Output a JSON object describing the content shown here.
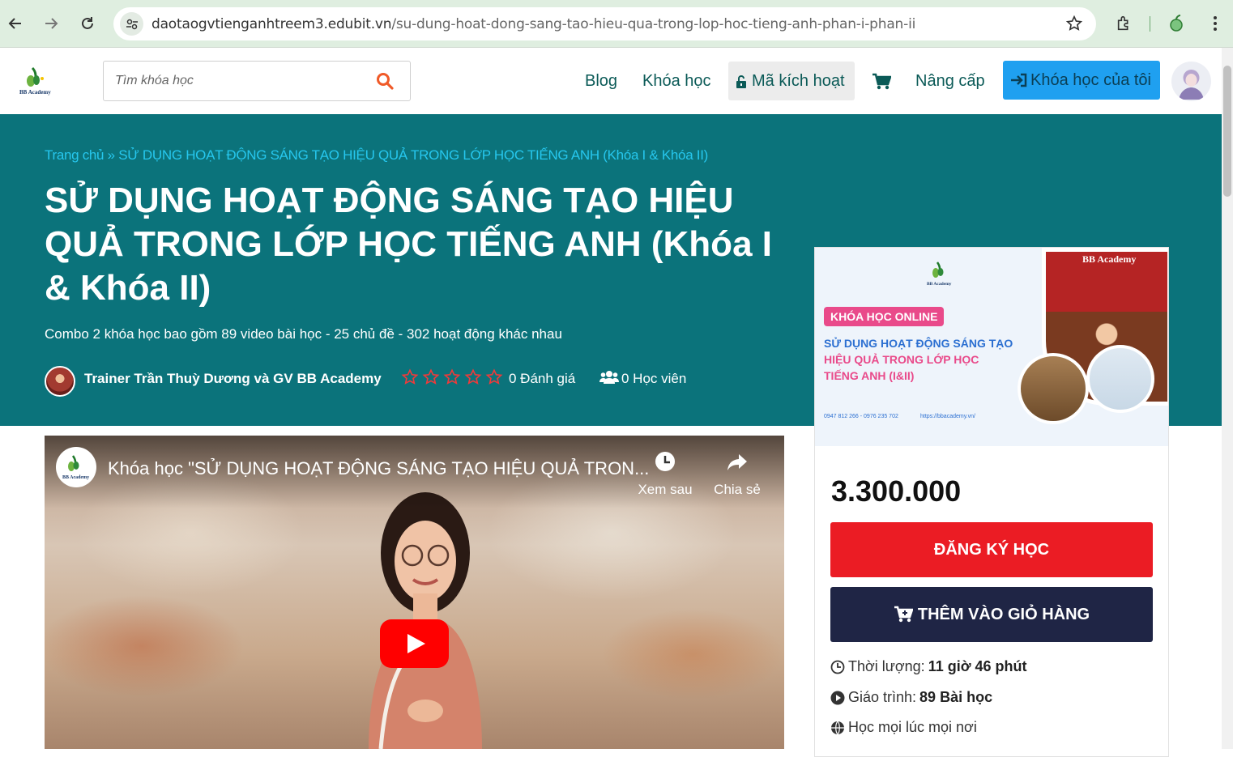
{
  "browser": {
    "url_host": "daotaogvtienganhtreem3.edubit.vn",
    "url_path": "/su-dung-hoat-dong-sang-tao-hieu-qua-trong-lop-hoc-tieng-anh-phan-i-phan-ii"
  },
  "header": {
    "logo_text": "BB Academy",
    "search_placeholder": "Tìm khóa học",
    "nav": {
      "blog": "Blog",
      "courses": "Khóa học",
      "activation": "Mã kích hoạt",
      "upgrade": "Nâng cấp",
      "my_courses": "Khóa học của tôi"
    }
  },
  "hero": {
    "breadcrumb_home": "Trang chủ",
    "breadcrumb_sep": "»",
    "breadcrumb_current": "SỬ DỤNG HOẠT ĐỘNG SÁNG TẠO HIỆU QUẢ TRONG LỚP HỌC TIẾNG ANH (Khóa I & Khóa II)",
    "title": "SỬ DỤNG HOẠT ĐỘNG SÁNG TẠO HIỆU QUẢ TRONG LỚP HỌC TIẾNG ANH (Khóa I & Khóa II)",
    "subtitle": "Combo 2 khóa học bao gồm 89 video bài học - 25 chủ đề - 302 hoạt động khác nhau",
    "trainer": "Trainer Trần Thuỳ Dương và GV BB Academy",
    "rating_stars": 0,
    "rating_text": "0 Đánh giá",
    "students_text": "0 Học viên"
  },
  "video": {
    "channel_logo_text": "BB Academy",
    "title": "Khóa học \"SỬ DỤNG HOẠT ĐỘNG SÁNG TẠO HIỆU QUẢ TRON...",
    "watch_later": "Xem sau",
    "share": "Chia sẻ"
  },
  "card": {
    "banner": {
      "logo_text": "BB Academy",
      "photo_label": "BB Academy",
      "badge": "KHÓA HỌC ONLINE",
      "line1": "SỬ DỤNG HOẠT ĐỘNG SÁNG TẠO",
      "line2": "HIỆU QUẢ TRONG LỚP HỌC",
      "line3": "TIẾNG ANH (I&II)",
      "contact": "0947 812 266 - 0976 235 702",
      "website": "https://bbacademy.vn/"
    },
    "price": "3.300.000",
    "register_label": "ĐĂNG KÝ HỌC",
    "cart_label": "THÊM VÀO GIỎ HÀNG",
    "duration_label": "Thời lượng:",
    "duration_value": "11 giờ 46 phút",
    "curriculum_label": "Giáo trình:",
    "curriculum_value": "89 Bài học",
    "anywhere_label": "Học mọi lúc mọi nơi"
  },
  "colors": {
    "hero_bg": "#0b737b",
    "breadcrumb": "#26c7ee",
    "nav_text": "#0b5a57",
    "primary_button": "#1fa0f0",
    "register_button": "#eb1c24",
    "cart_button": "#1f2545"
  }
}
